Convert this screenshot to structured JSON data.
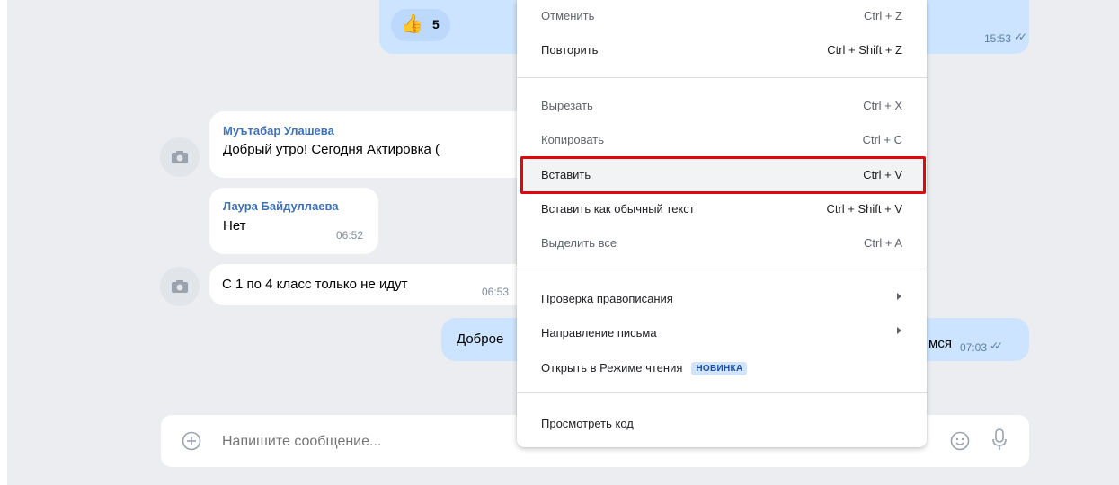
{
  "chat": {
    "reaction": {
      "emoji": "👍",
      "count": "5"
    },
    "top_bubble_time": "15:53",
    "messages": [
      {
        "sender": "Муътабар Улашева",
        "text": "Добрый утро! Сегодня Актировка ("
      },
      {
        "sender": "Лаура Байдуллаева",
        "text": "Нет",
        "time": "06:52"
      },
      {
        "text": "С 1 по 4 класс только не идут",
        "time": "06:53"
      }
    ],
    "outgoing": {
      "text_left": "Доброе",
      "text_right": "мся",
      "time": "07:03"
    }
  },
  "composer": {
    "placeholder": "Напишите сообщение..."
  },
  "context_menu": {
    "undo": {
      "label": "Отменить",
      "shortcut": "Ctrl + Z"
    },
    "redo": {
      "label": "Повторить",
      "shortcut": "Ctrl + Shift + Z"
    },
    "cut": {
      "label": "Вырезать",
      "shortcut": "Ctrl + X"
    },
    "copy": {
      "label": "Копировать",
      "shortcut": "Ctrl + C"
    },
    "paste": {
      "label": "Вставить",
      "shortcut": "Ctrl + V"
    },
    "paste_plain": {
      "label": "Вставить как обычный текст",
      "shortcut": "Ctrl + Shift + V"
    },
    "select_all": {
      "label": "Выделить все",
      "shortcut": "Ctrl + A"
    },
    "spellcheck": {
      "label": "Проверка правописания"
    },
    "writing_direction": {
      "label": "Направление письма"
    },
    "reading_mode": {
      "label": "Открыть в Режиме чтения",
      "badge": "НОВИНКА"
    },
    "inspect": {
      "label": "Просмотреть код"
    }
  },
  "colors": {
    "highlight_border": "#e0060a",
    "outgoing_bubble": "#cce4ff",
    "chat_background": "#ebedf0",
    "sender_name": "#3f72b5"
  }
}
